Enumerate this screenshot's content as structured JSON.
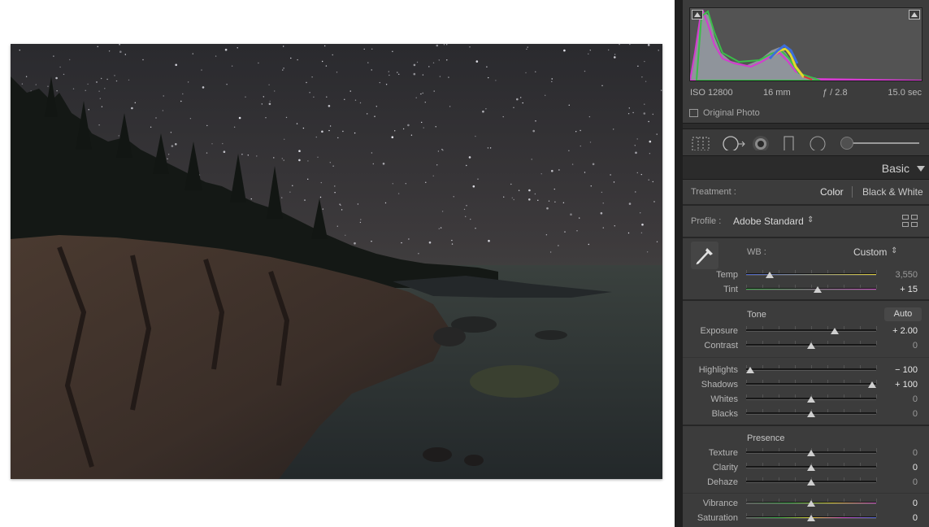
{
  "histogram": {
    "iso": "ISO 12800",
    "focal": "16 mm",
    "aperture": "ƒ / 2.8",
    "shutter": "15.0 sec",
    "original_photo_label": "Original Photo"
  },
  "tools": [
    "crop-overlay-icon",
    "spot-removal-icon",
    "red-eye-icon",
    "graduated-filter-icon",
    "radial-filter-icon",
    "adjustment-brush-icon"
  ],
  "basic": {
    "title": "Basic",
    "treatment_label": "Treatment :",
    "treatment_color": "Color",
    "treatment_bw": "Black & White",
    "profile_label": "Profile :",
    "profile_value": "Adobe Standard",
    "wb_label": "WB :",
    "wb_value": "Custom",
    "temp": {
      "label": "Temp",
      "value": "3,550",
      "position": 0.18
    },
    "tint": {
      "label": "Tint",
      "value": "+ 15",
      "position": 0.55
    },
    "tone_label": "Tone",
    "auto_label": "Auto",
    "exposure": {
      "label": "Exposure",
      "value": "+ 2.00",
      "position": 0.68
    },
    "contrast": {
      "label": "Contrast",
      "value": "0",
      "position": 0.5
    },
    "highlights": {
      "label": "Highlights",
      "value": "− 100",
      "position": 0.0
    },
    "shadows": {
      "label": "Shadows",
      "value": "+ 100",
      "position": 1.0
    },
    "whites": {
      "label": "Whites",
      "value": "0",
      "position": 0.5
    },
    "blacks": {
      "label": "Blacks",
      "value": "0",
      "position": 0.5
    },
    "presence_label": "Presence",
    "texture": {
      "label": "Texture",
      "value": "0",
      "position": 0.5
    },
    "clarity": {
      "label": "Clarity",
      "value": "0",
      "position": 0.5
    },
    "dehaze": {
      "label": "Dehaze",
      "value": "0",
      "position": 0.5
    },
    "vibrance": {
      "label": "Vibrance",
      "value": "0",
      "position": 0.5
    },
    "saturation": {
      "label": "Saturation",
      "value": "0",
      "position": 0.5
    }
  },
  "colors": {
    "panel_bg": "#3c3c3c",
    "temp_gradient": [
      "#4a63c9",
      "#d9c83a"
    ],
    "tint_gradient": [
      "#3fae4a",
      "#c84bc0"
    ]
  }
}
